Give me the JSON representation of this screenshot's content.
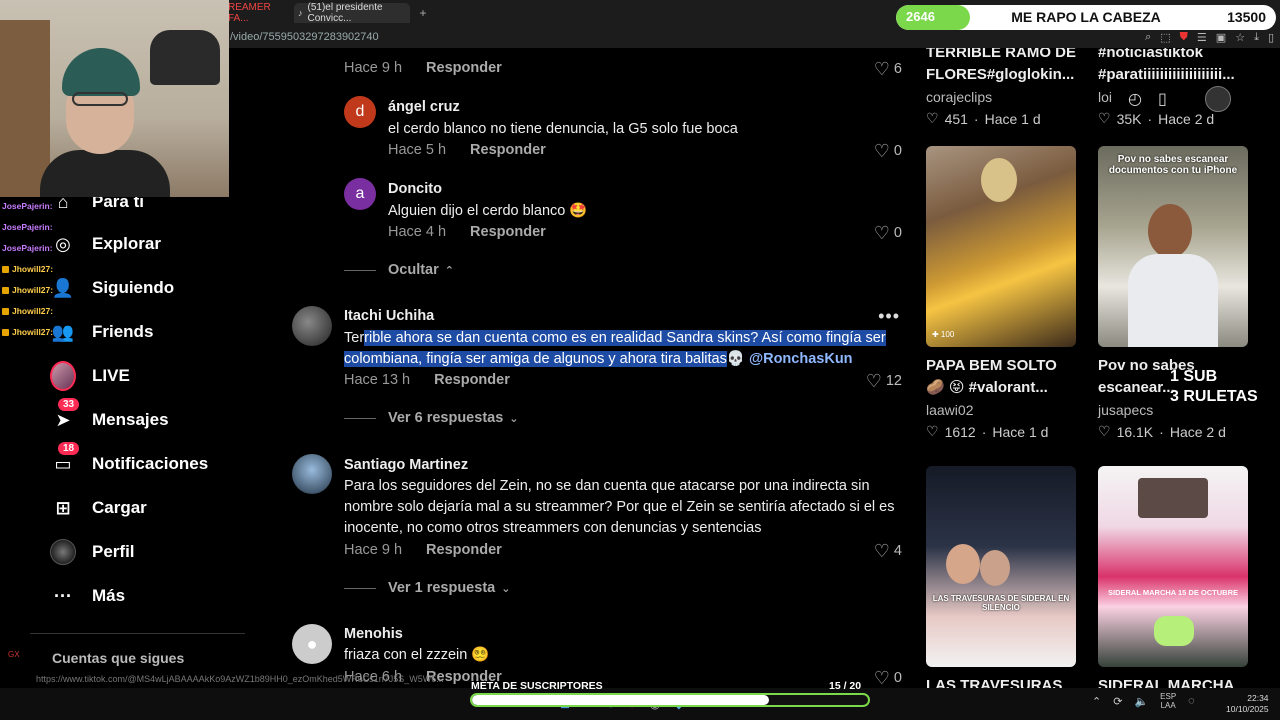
{
  "browser": {
    "tabs": [
      {
        "label": "REAMER FA..."
      },
      {
        "label": "(51)el presidente Convicc..."
      }
    ],
    "new_tab": "+",
    "url": "/video/7559503297283902740"
  },
  "goal_overlay": {
    "current": "2646",
    "title": "ME RAPO LA CABEZA",
    "target": "13500",
    "progress": 0.196
  },
  "chat": [
    {
      "user": "JosePajerin:",
      "badge": false
    },
    {
      "user": "JosePajerin:",
      "badge": false
    },
    {
      "user": "JosePajerin:",
      "badge": false
    },
    {
      "user": "Jhowill27:",
      "badge": true
    },
    {
      "user": "Jhowill27:",
      "badge": true
    },
    {
      "user": "Jhowill27:",
      "badge": true
    },
    {
      "user": "Jhowill27:",
      "badge": true
    }
  ],
  "sidebar": {
    "items": [
      {
        "label": "Para ti",
        "icon": "home-icon"
      },
      {
        "label": "Explorar",
        "icon": "compass-icon"
      },
      {
        "label": "Siguiendo",
        "icon": "user-follow-icon"
      },
      {
        "label": "Friends",
        "icon": "friends-icon"
      },
      {
        "label": "LIVE",
        "icon": "live-icon"
      },
      {
        "label": "Mensajes",
        "icon": "message-icon",
        "badge": "33"
      },
      {
        "label": "Notificaciones",
        "icon": "inbox-icon",
        "badge": "18"
      },
      {
        "label": "Cargar",
        "icon": "upload-icon"
      },
      {
        "label": "Perfil",
        "icon": "avatar-icon"
      },
      {
        "label": "Más",
        "icon": "more-icon"
      }
    ],
    "following_title": "Cuentas que sigues"
  },
  "comments": {
    "top_meta": {
      "time": "Hace 9 h",
      "reply": "Responder",
      "likes": "6"
    },
    "items": [
      {
        "initial": "d",
        "name": "ángel cruz",
        "text": "el cerdo blanco no tiene denuncia, la G5 solo fue boca",
        "time": "Hace 5 h",
        "reply": "Responder",
        "likes": "0"
      },
      {
        "initial": "a",
        "name": "Doncito",
        "text": "Alguien dijo el cerdo blanco 🤩",
        "time": "Hace 4 h",
        "reply": "Responder",
        "likes": "0"
      }
    ],
    "hide_label": "Ocultar",
    "itachi": {
      "name": "Itachi Uchiha",
      "text_unsel": "Ter",
      "text_sel_1": "rible ahora se dan cuenta como es en realidad Sandra skins? Así como fingía ser",
      "text_sel_2": "colombiana, fingía ser amiga de algunos y ahora tira balitas",
      "emoji": "💀 ",
      "mention": "@RonchasKun",
      "time": "Hace 13 h",
      "reply": "Responder",
      "likes": "12",
      "view_replies": "Ver 6 respuestas"
    },
    "santiago": {
      "name": "Santiago Martinez",
      "text_1": "Para los seguidores del Zein, no se dan cuenta que atacarse por una indirecta sin",
      "text_2": "nombre solo dejaría mal a su streammer? Por que el Zein se sentiría afectado si el es",
      "text_3": "inocente, no como otros streammers con denuncias y sentencias",
      "time": "Hace 9 h",
      "reply": "Responder",
      "likes": "4",
      "view_replies": "Ver 1 respuesta"
    },
    "menohis": {
      "name": "Menohis",
      "text": "friaza con el zzzein 😵‍💫",
      "time": "Hace 6 h",
      "reply": "Responder",
      "likes": "0"
    }
  },
  "grid": {
    "top_left": {
      "title": "TERRIBLE RAMO DE",
      "title2": "FLORES#gloglokin...",
      "author": "corajeclips",
      "likes": "451",
      "time": "Hace 1 d"
    },
    "top_right": {
      "title": "#noticiastiktok",
      "title2": "#paratiiiiiiiiiiiiiiiiiii...",
      "author": "loi",
      "likes": "35K",
      "time": "Hace 2 d"
    },
    "cards": [
      {
        "title": "PAPA BEM SOLTO",
        "title2": "🥔 😝 #valorant...",
        "author": "laawi02",
        "likes": "1612",
        "time": "Hace 1 d",
        "thumb_text": ""
      },
      {
        "title": "Pov no sabes",
        "title2": "escanear...",
        "author": "jusapecs",
        "likes": "16.1K",
        "time": "Hace 2 d",
        "thumb_text": "Pov no sabes escanear documentos con tu iPhone"
      },
      {
        "title": "LAS TRAVESURAS",
        "title2": "",
        "author": "",
        "likes": "",
        "time": "",
        "thumb_text": "LAS TRAVESURAS DE SIDERAL EN SILENCIO"
      },
      {
        "title": "SIDERAL MARCHA",
        "title2": "",
        "author": "",
        "likes": "",
        "time": "",
        "thumb_text": "SIDERAL MARCHA 15 DE OCTUBRE"
      }
    ],
    "side_overlay_1": "1 SUB",
    "side_overlay_2": "3 RULETAS"
  },
  "bottom": {
    "status_url": "https://www.tiktok.com/@MS4wLjABAAAAkKo9AzWZ1b89HH0_ezOmKhed5WRuCs1n7J5S_W5W6...",
    "sub_goal_title": "META DE SUSCRIPTORES",
    "sub_goal_count": "15 / 20",
    "sub_goal_progress": 0.75,
    "lang_1": "ESP",
    "lang_2": "LAA",
    "time": "22:34",
    "date": "10/10/2025",
    "gx": "GX"
  },
  "colors": {
    "accent": "#fe2c55",
    "selection": "#1e4ba3",
    "goal_green": "#7ad84a"
  }
}
